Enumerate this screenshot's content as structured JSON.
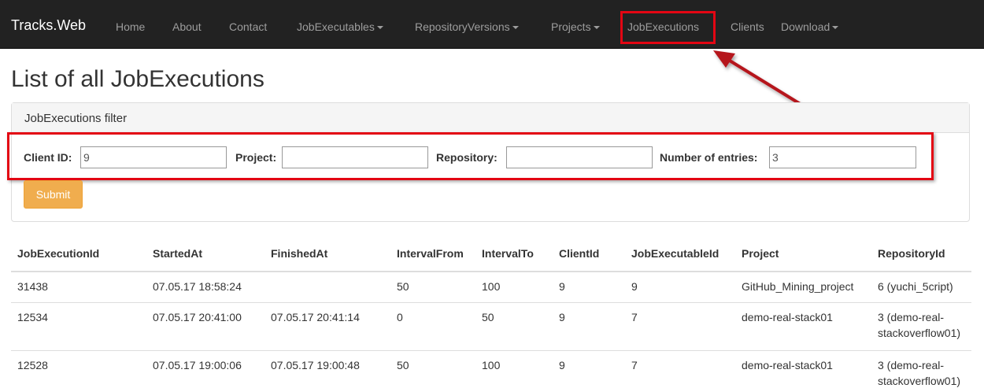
{
  "navbar": {
    "brand": "Tracks.Web",
    "items": [
      {
        "label": "Home",
        "dropdown": false
      },
      {
        "label": "About",
        "dropdown": false
      },
      {
        "label": "Contact",
        "dropdown": false
      },
      {
        "label": "JobExecutables",
        "dropdown": true
      },
      {
        "label": "RepositoryVersions",
        "dropdown": true
      },
      {
        "label": "Projects",
        "dropdown": true
      },
      {
        "label": "JobExecutions",
        "dropdown": false,
        "active": true
      },
      {
        "label": "Clients",
        "dropdown": false
      },
      {
        "label": "Download",
        "dropdown": true
      }
    ]
  },
  "page": {
    "title": "List of all JobExecutions"
  },
  "filter": {
    "heading": "JobExecutions filter",
    "client_label": "Client ID:",
    "client_value": "9",
    "project_label": "Project:",
    "project_value": "",
    "repository_label": "Repository:",
    "repository_value": "",
    "entries_label": "Number of entries:",
    "entries_value": "3",
    "submit_label": "Submit"
  },
  "table": {
    "headers": [
      "JobExecutionId",
      "StartedAt",
      "FinishedAt",
      "IntervalFrom",
      "IntervalTo",
      "ClientId",
      "JobExecutableId",
      "Project",
      "RepositoryId"
    ],
    "rows": [
      [
        "31438",
        "07.05.17 18:58:24",
        "",
        "50",
        "100",
        "9",
        "9",
        "GitHub_Mining_project",
        "6 (yuchi_5cript)"
      ],
      [
        "12534",
        "07.05.17 20:41:00",
        "07.05.17 20:41:14",
        "0",
        "50",
        "9",
        "7",
        "demo-real-stack01",
        "3 (demo-real-stackoverflow01)"
      ],
      [
        "12528",
        "07.05.17 19:00:06",
        "07.05.17 19:00:48",
        "50",
        "100",
        "9",
        "7",
        "demo-real-stack01",
        "3 (demo-real-stackoverflow01)"
      ]
    ]
  },
  "colors": {
    "navbar_bg": "#222222",
    "highlight_red": "#e30613",
    "submit_orange": "#f0ad4e"
  }
}
